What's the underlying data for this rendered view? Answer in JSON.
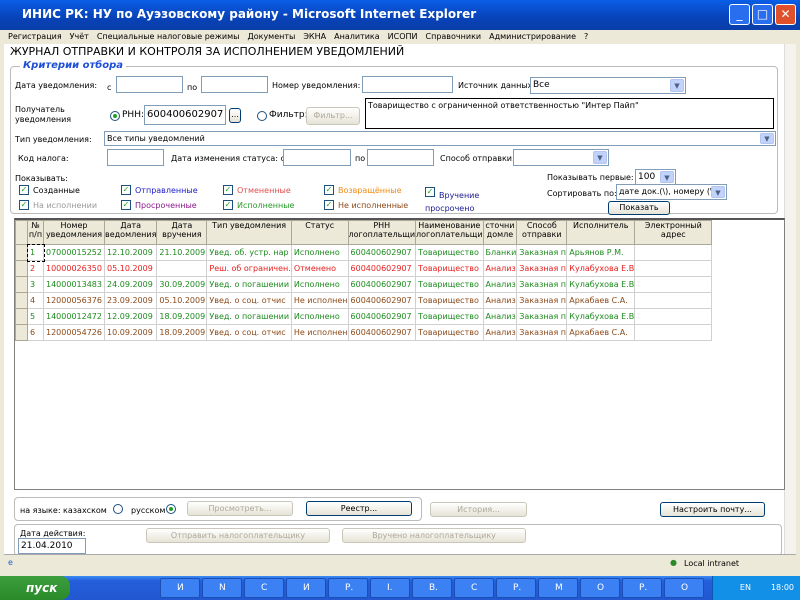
{
  "window": {
    "title": "ИНИС РК: НУ по Ауэзовскому району - Microsoft Internet Explorer"
  },
  "menu": [
    "Регистрация",
    "Учёт",
    "Специальные налоговые режимы",
    "Документы",
    "ЭКНА",
    "Аналитика",
    "ИСОПИ",
    "Справочники",
    "Администрирование",
    "?"
  ],
  "page_title": "ЖУРНАЛ ОТПРАВКИ И КОНТРОЛЯ ЗА ИСПОЛНЕНИЕМ УВЕДОМЛЕНИЙ",
  "criteria": {
    "legend": "Критерии отбора",
    "date_label": "Дата уведомления:",
    "from": "с",
    "to": "по",
    "number_label": "Номер уведомления:",
    "source_label": "Источник данных:",
    "source_value": "Все",
    "recipient_label": "Получатель уведомления",
    "rnn_label": "РНН:",
    "rnn_value": "600400602907",
    "ellipsis": "...",
    "filter_label": "Фильтр:",
    "filter_button": "Фильтр...",
    "recipient_name": "Товарищество с ограниченной ответственностью \"Интер Пайп\"",
    "type_label": "Тип уведомления:",
    "type_value": "Все типы уведомлений",
    "tax_code_label": "Код налога:",
    "status_date_label": "Дата изменения статуса: с",
    "status_date_to": "по",
    "send_method_label": "Способ отправки:",
    "show_label": "Показывать:",
    "checks": [
      "Созданные",
      "Отправленные",
      "Отмененные",
      "Возвращённые",
      "Вручение просрочено",
      "На исполнении",
      "Просроченные",
      "Исполненные",
      "Не исполненные"
    ],
    "show_first_label": "Показывать первые:",
    "show_first_value": "100",
    "sort_label": "Сортировать по:",
    "sort_value": "дате док.(\\), номеру (\\)",
    "show_button": "Показать"
  },
  "table": {
    "headers": [
      "№ п/п",
      "Номер уведомления",
      "Дата ведомления",
      "Дата вручения",
      "Тип уведомления",
      "Статус",
      "РНН логоплательщи",
      "Наименование логоплательщи",
      "сточни домле",
      "Способ отправки",
      "Исполнитель",
      "Электронный адрес"
    ],
    "rows": [
      [
        "1",
        "07000015252",
        "12.10.2009",
        "21.10.2009",
        "Увед. об. устр. нар",
        "Исполнено",
        "600400602907",
        "Товарищество",
        "Бланки",
        "Заказная п",
        "Арьянов Р.М.",
        ""
      ],
      [
        "2",
        "10000026350",
        "05.10.2009",
        "",
        "Реш. об ограничен.",
        "Отменено",
        "600400602907",
        "Товарищество",
        "Анализ",
        "Заказная п",
        "Кулабухова Е.В",
        ""
      ],
      [
        "3",
        "14000013483",
        "24.09.2009",
        "30.09.2009",
        "Увед. о погашении",
        "Исполнено",
        "600400602907",
        "Товарищество",
        "Анализ",
        "Заказная п",
        "Кулабухова Е.В",
        ""
      ],
      [
        "4",
        "12000056376",
        "23.09.2009",
        "05.10.2009",
        "Увед. о соц. отчис",
        "Не исполнен",
        "600400602907",
        "Товарищество",
        "Анализ",
        "Заказная п",
        "Аркабаев С.А.",
        ""
      ],
      [
        "5",
        "14000012472",
        "12.09.2009",
        "18.09.2009",
        "Увед. о погашении",
        "Исполнено",
        "600400602907",
        "Товарищество",
        "Анализ",
        "Заказная п",
        "Кулабухова Е.В",
        ""
      ],
      [
        "6",
        "12000054726",
        "10.09.2009",
        "18.09.2009",
        "Увед. о соц. отчис",
        "Не исполнен",
        "600400602907",
        "Товарищество",
        "Анализ",
        "Заказная п",
        "Аркабаев С.А.",
        ""
      ]
    ],
    "row_colors": [
      "g",
      "r",
      "g",
      "b",
      "g",
      "b"
    ]
  },
  "bottom": {
    "lang_label": "на языке: казахском",
    "lang_ru": "русском",
    "view_button": "Просмотреть...",
    "registry_button": "Реестр...",
    "history_button": "История...",
    "mail_button": "Настроить почту...",
    "action_date_label": "Дата действия:",
    "action_date_value": "21.04.2010",
    "send_button": "Отправить налогоплательщику",
    "delivered_button": "Вручено налогоплательщику"
  },
  "statusbar": {
    "zone": "Local intranet"
  },
  "taskbar": {
    "start": "пуск",
    "tasks": [
      "И",
      "N",
      "С",
      "И",
      "Р.",
      "I.",
      "В.",
      "С",
      "Р.",
      "М",
      "О",
      "Р.",
      "О"
    ],
    "lang": "EN",
    "time": "18:00"
  }
}
